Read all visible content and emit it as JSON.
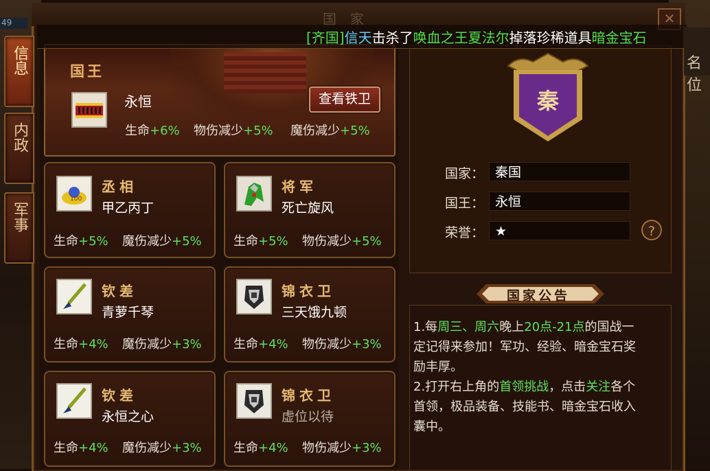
{
  "window": {
    "title": "国家",
    "close_icon": "close-icon",
    "corner_number": "49"
  },
  "side_tabs": [
    {
      "label": "信息",
      "active": true
    },
    {
      "label": "内政",
      "active": false
    },
    {
      "label": "军事",
      "active": false
    }
  ],
  "ticker": {
    "part1": "[齐国]",
    "part2": "信天",
    "part3": "击杀了",
    "part4": "唤血之王夏法尔",
    "part5": "掉落珍稀道具",
    "part6": "暗金宝石"
  },
  "ribbon_right": "名位",
  "king": {
    "title": "国王",
    "name": "永恒",
    "stat1_label": "生命",
    "stat1_value": "+6%",
    "stat2_label": "物伤减少",
    "stat2_value": "+5%",
    "stat3_label": "魔伤减少",
    "stat3_value": "+5%",
    "button": "查看铁卫"
  },
  "officials": [
    {
      "title": "丞相",
      "name": "甲乙丙丁",
      "icon": "chancellor-seal-icon",
      "stat1_label": "生命",
      "stat1_value": "+5%",
      "stat2_label": "魔伤减少",
      "stat2_value": "+5%"
    },
    {
      "title": "将军",
      "name": "死亡旋风",
      "icon": "general-armor-icon",
      "stat1_label": "生命",
      "stat1_value": "+5%",
      "stat2_label": "物伤减少",
      "stat2_value": "+5%"
    },
    {
      "title": "钦差",
      "name": "青萝千琴",
      "icon": "brush-icon",
      "stat1_label": "生命",
      "stat1_value": "+4%",
      "stat2_label": "魔伤减少",
      "stat2_value": "+3%"
    },
    {
      "title": "锦衣卫",
      "name": "三天饿九顿",
      "icon": "guard-badge-icon",
      "stat1_label": "生命",
      "stat1_value": "+4%",
      "stat2_label": "物伤减少",
      "stat2_value": "+3%"
    },
    {
      "title": "钦差",
      "name": "永恒之心",
      "icon": "brush-icon",
      "stat1_label": "生命",
      "stat1_value": "+4%",
      "stat2_label": "魔伤减少",
      "stat2_value": "+3%"
    },
    {
      "title": "锦衣卫",
      "name": "虚位以待",
      "icon": "guard-badge-icon",
      "stat1_label": "生命",
      "stat1_value": "+4%",
      "stat2_label": "物伤减少",
      "stat2_value": "+3%"
    }
  ],
  "info": {
    "emblem_char": "秦",
    "country_label": "国家：",
    "country_value": "秦国",
    "king_label": "国王：",
    "king_value": "永恒",
    "honor_label": "荣誉：",
    "honor_value": "★",
    "help": "?"
  },
  "notice": {
    "title": "国家公告",
    "l1a": "1.每",
    "l1b": "周三、周六",
    "l1c": "晚上",
    "l1d": "20点-21点",
    "l1e": "的国战一",
    "l2": "定记得来参加！军功、经验、暗金宝石奖",
    "l3": "励丰厚。",
    "l4a": "2.打开右上角的",
    "l4b": "首领挑战",
    "l4c": "，点击",
    "l4d": "关注",
    "l4e": "各个",
    "l5": "首领，极品装备、技能书、暗金宝石收入",
    "l6": "囊中。"
  },
  "colors": {
    "gold": "#e6ba72",
    "green": "#5ee05e",
    "cyan": "#5fd0ff",
    "frame": "#7a4e26",
    "emblem_purple": "#6a2a8a"
  }
}
